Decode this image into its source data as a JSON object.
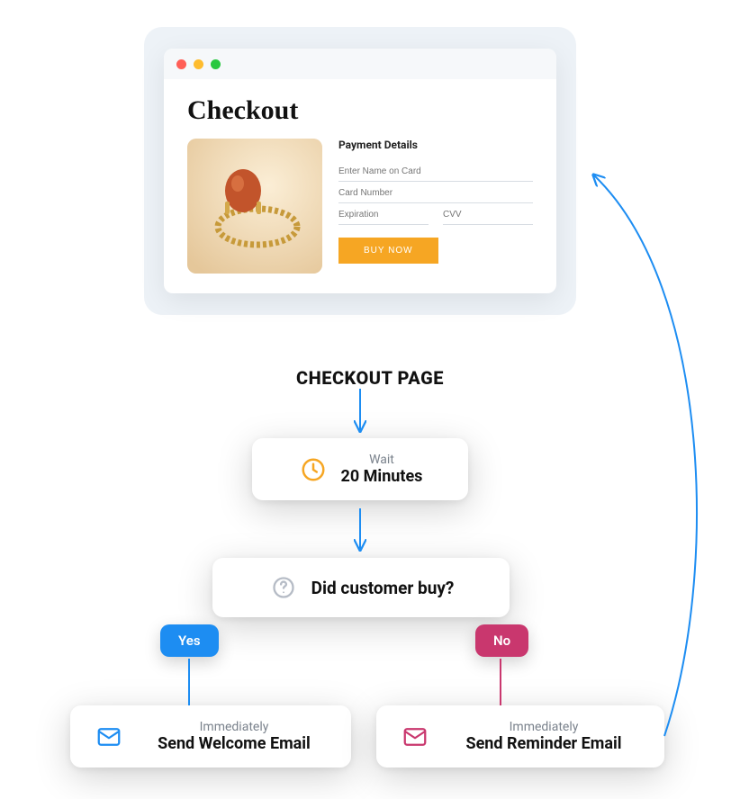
{
  "checkout": {
    "title": "Checkout",
    "paymentHeading": "Payment Details",
    "namePlaceholder": "Enter Name on Card",
    "cardPlaceholder": "Card Number",
    "expPlaceholder": "Expiration",
    "cvvPlaceholder": "CVV",
    "buyLabel": "BUY NOW"
  },
  "checkoutPageLabel": "CHECKOUT PAGE",
  "wait": {
    "small": "Wait",
    "big": "20 Minutes"
  },
  "question": {
    "text": "Did customer buy?"
  },
  "yesLabel": "Yes",
  "noLabel": "No",
  "welcome": {
    "small": "Immediately",
    "big": "Send Welcome Email"
  },
  "reminder": {
    "small": "Immediately",
    "big": "Send Reminder Email"
  }
}
